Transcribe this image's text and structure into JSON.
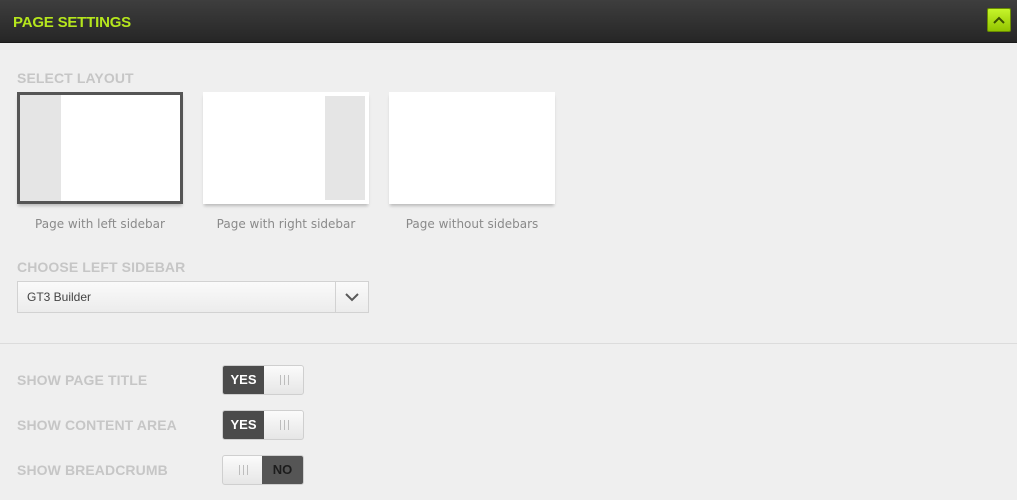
{
  "header": {
    "title": "PAGE SETTINGS",
    "accent_color": "#b5e61d",
    "collapse_icon": "chevron-up-icon"
  },
  "layout_section": {
    "label": "SELECT LAYOUT",
    "options": [
      {
        "id": "left-sidebar",
        "caption": "Page with left sidebar",
        "selected": true
      },
      {
        "id": "right-sidebar",
        "caption": "Page with right sidebar",
        "selected": false
      },
      {
        "id": "no-sidebar",
        "caption": "Page without sidebars",
        "selected": false
      }
    ]
  },
  "sidebar_section": {
    "label": "CHOOSE LEFT SIDEBAR",
    "selected_value": "GT3 Builder",
    "dropdown_icon": "chevron-down-icon"
  },
  "toggles": [
    {
      "label": "SHOW PAGE TITLE",
      "state": "YES"
    },
    {
      "label": "SHOW CONTENT AREA",
      "state": "YES"
    },
    {
      "label": "SHOW BREADCRUMB",
      "state": "NO"
    }
  ]
}
